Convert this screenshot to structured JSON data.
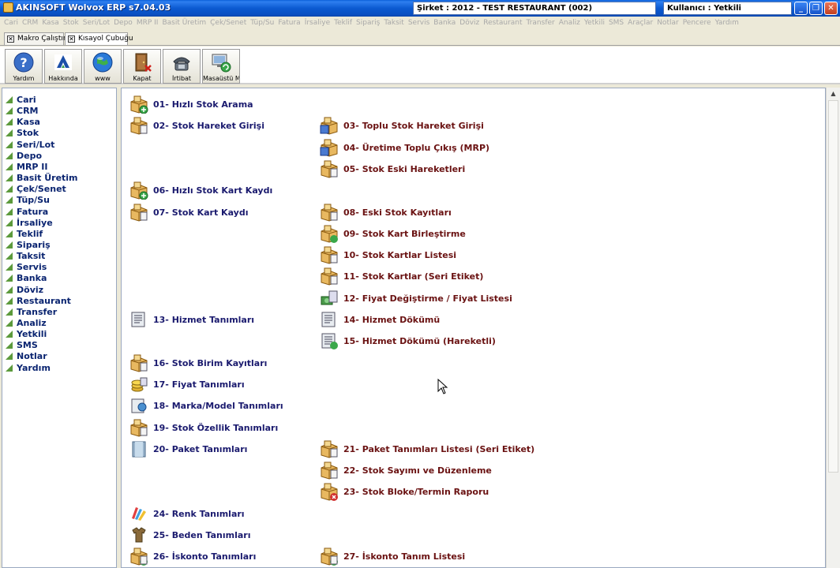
{
  "window": {
    "title": "AKINSOFT Wolvox ERP s7.04.03",
    "company": "Şirket : 2012 - TEST RESTAURANT (002)",
    "user": "Kullanıcı : Yetkili",
    "minimize_label": "_",
    "restore_label": "❐",
    "close_label": "✕"
  },
  "menu": [
    "Cari",
    "CRM",
    "Kasa",
    "Stok",
    "Seri/Lot",
    "Depo",
    "MRP II",
    "Basit Üretim",
    "Çek/Senet",
    "Tüp/Su",
    "Fatura",
    "İrsaliye",
    "Teklif",
    "Sipariş",
    "Taksit",
    "Servis",
    "Banka",
    "Döviz",
    "Restaurant",
    "Transfer",
    "Analiz",
    "Yetkili",
    "SMS",
    "Araçlar",
    "Notlar",
    "Pencere",
    "Yardım"
  ],
  "tabs": [
    {
      "label": "Makro Çalıştır",
      "check": "✕"
    },
    {
      "label": "Kısayol Çubuğu",
      "check": "✕"
    }
  ],
  "shortcuts": [
    {
      "label": "Yardım",
      "icon": "help-icon"
    },
    {
      "label": "Hakkında",
      "icon": "akinsoft-logo-icon"
    },
    {
      "label": "www",
      "icon": "globe-icon"
    },
    {
      "label": "Kapat",
      "icon": "exit-door-icon"
    },
    {
      "label": "İrtibat",
      "icon": "telephone-icon"
    },
    {
      "label": "Masaüstü M",
      "icon": "desktop-refresh-icon"
    }
  ],
  "sidebar": [
    "Cari",
    "CRM",
    "Kasa",
    "Stok",
    "Seri/Lot",
    "Depo",
    "MRP II",
    "Basit Üretim",
    "Çek/Senet",
    "Tüp/Su",
    "Fatura",
    "İrsaliye",
    "Teklif",
    "Sipariş",
    "Taksit",
    "Servis",
    "Banka",
    "Döviz",
    "Restaurant",
    "Transfer",
    "Analiz",
    "Yetkili",
    "SMS",
    "Notlar",
    "Yardım"
  ],
  "links_col1": [
    {
      "label": "01- Hızlı Stok Arama",
      "icon": "box-search-icon"
    },
    {
      "label": "02- Stok Hareket Girişi",
      "icon": "box-document-icon"
    },
    {
      "label": "06- Hızlı Stok Kart Kaydı",
      "icon": "box-add-icon"
    },
    {
      "label": "07- Stok Kart Kaydı",
      "icon": "box-card-icon"
    },
    {
      "label": "13- Hizmet Tanımları",
      "icon": "service-list-icon"
    },
    {
      "label": "16- Stok Birim Kayıtları",
      "icon": "box-units-icon"
    },
    {
      "label": "17- Fiyat Tanımları",
      "icon": "coins-price-icon"
    },
    {
      "label": "18- Marka/Model Tanımları",
      "icon": "brand-model-icon"
    },
    {
      "label": "19- Stok Özellik Tanımları",
      "icon": "box-properties-icon"
    },
    {
      "label": "20- Paket Tanımları",
      "icon": "package-icon"
    },
    {
      "label": "24- Renk Tanımları",
      "icon": "color-palette-icon"
    },
    {
      "label": "25- Beden Tanımları",
      "icon": "shirt-icon"
    },
    {
      "label": "26- İskonto Tanımları",
      "icon": "discount-icon"
    }
  ],
  "links_col2": [
    {
      "label": "03- Toplu Stok Hareket Girişi",
      "icon": "boxes-bulk-icon"
    },
    {
      "label": "04- Üretime Toplu Çıkış (MRP)",
      "icon": "boxes-production-icon"
    },
    {
      "label": "05- Stok Eski Hareketleri",
      "icon": "box-history-icon"
    },
    {
      "label": "08- Eski Stok Kayıtları",
      "icon": "box-old-records-icon"
    },
    {
      "label": "09- Stok Kart Birleştirme",
      "icon": "box-merge-icon"
    },
    {
      "label": "10- Stok Kartlar Listesi",
      "icon": "box-list-icon"
    },
    {
      "label": "11- Stok Kartlar (Seri Etiket)",
      "icon": "box-label-icon"
    },
    {
      "label": "12- Fiyat Değiştirme / Fiyat Listesi",
      "icon": "price-change-icon"
    },
    {
      "label": "14- Hizmet Dökümü",
      "icon": "service-report-icon"
    },
    {
      "label": "15- Hizmet Dökümü (Hareketli)",
      "icon": "service-report-refresh-icon"
    },
    {
      "label": "21- Paket Tanımları Listesi (Seri Etiket)",
      "icon": "package-list-icon"
    },
    {
      "label": "22- Stok Sayımı ve Düzenleme",
      "icon": "stock-count-icon"
    },
    {
      "label": "23- Stok Bloke/Termin Raporu",
      "icon": "stock-block-icon"
    },
    {
      "label": "27- İskonto Tanım Listesi",
      "icon": "discount-list-icon"
    }
  ],
  "colors": {
    "titlebar": "#0a5fd8",
    "link_dark_blue": "#1a1a6e",
    "link_dark_red": "#6a1212",
    "sidebar_text": "#0a2470",
    "sidebar_arrow": "#5c9a3c"
  }
}
